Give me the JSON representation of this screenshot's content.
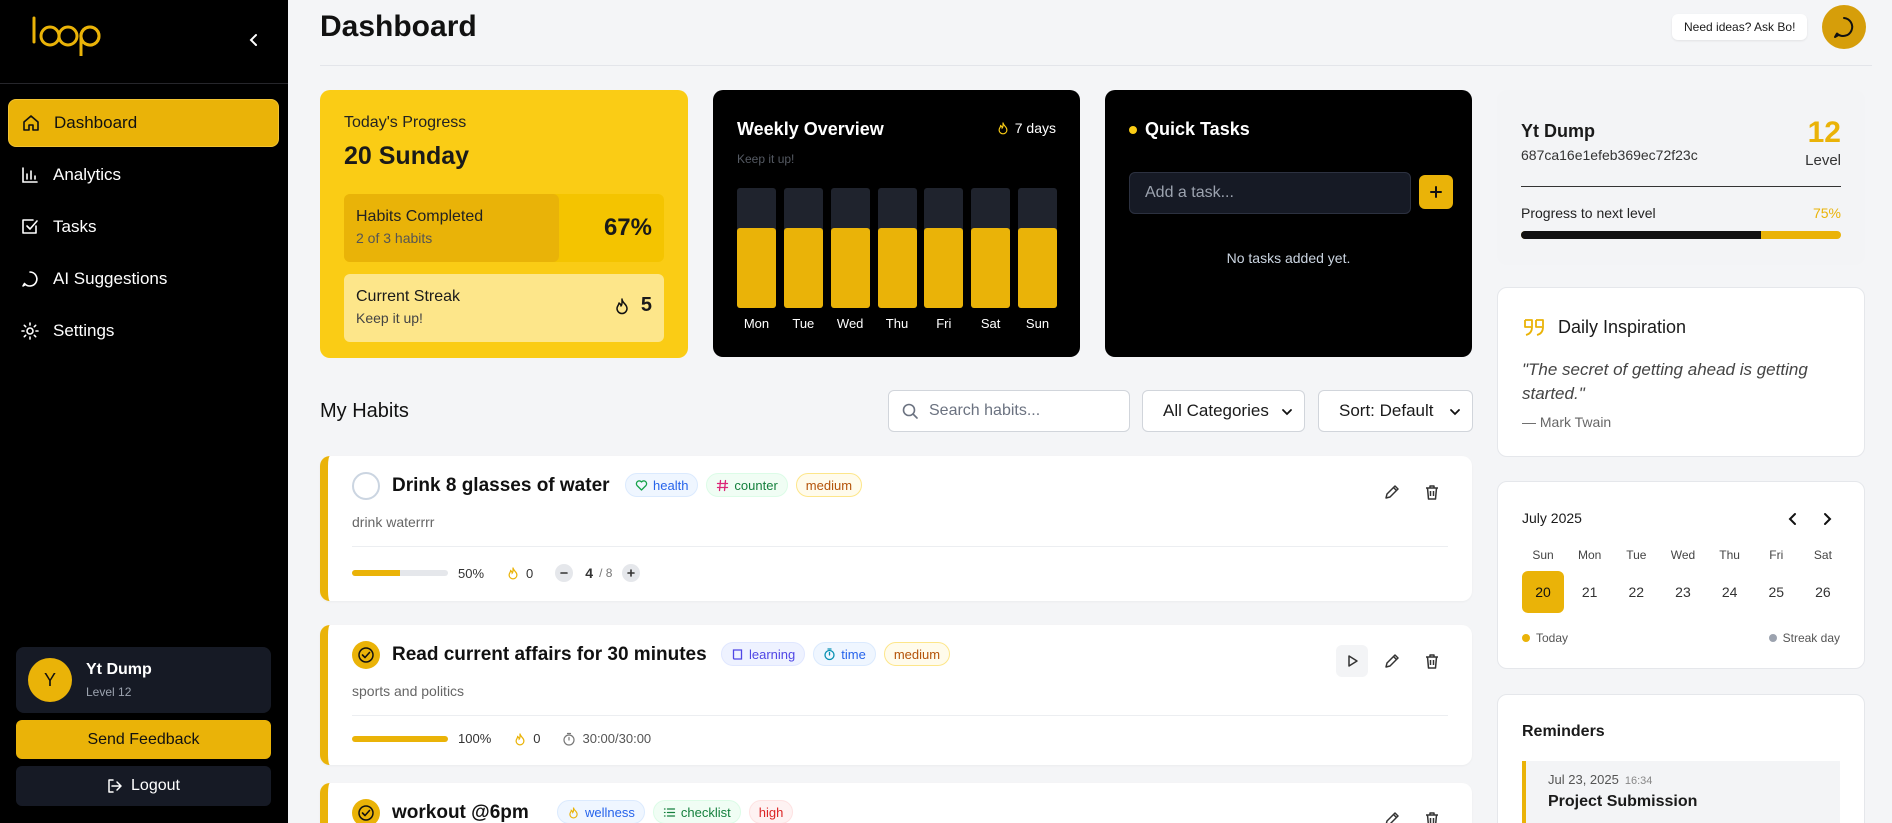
{
  "app": {
    "logo_text": "loop"
  },
  "sidebar": {
    "items": [
      {
        "label": "Dashboard",
        "icon": "home-icon",
        "active": true
      },
      {
        "label": "Analytics",
        "icon": "bar-chart-icon"
      },
      {
        "label": "Tasks",
        "icon": "checkbox-icon"
      },
      {
        "label": "AI Suggestions",
        "icon": "message-icon"
      },
      {
        "label": "Settings",
        "icon": "gear-icon"
      }
    ],
    "user": {
      "initial": "Y",
      "name": "Yt Dump",
      "level": "Level 12"
    },
    "feedback_label": "Send Feedback",
    "logout_label": "Logout"
  },
  "header": {
    "title": "Dashboard",
    "ask_label": "Need ideas? Ask Bo!"
  },
  "progress_card": {
    "label": "Today's Progress",
    "date": "20 Sunday",
    "habits_title": "Habits Completed",
    "habits_sub": "2 of 3 habits",
    "habits_pct": "67%",
    "streak_title": "Current Streak",
    "streak_sub": "Keep it up!",
    "streak_value": "5"
  },
  "weekly": {
    "title": "Weekly Overview",
    "subtitle": "Keep it up!",
    "streak_label": "7 days"
  },
  "chart_data": {
    "type": "bar",
    "categories": [
      "Mon",
      "Tue",
      "Wed",
      "Thu",
      "Fri",
      "Sat",
      "Sun"
    ],
    "values": [
      67,
      67,
      67,
      67,
      67,
      67,
      67
    ],
    "ylim": [
      0,
      100
    ]
  },
  "quick_tasks": {
    "title": "Quick Tasks",
    "placeholder": "Add a task...",
    "empty": "No tasks added yet."
  },
  "level_card": {
    "name": "Yt Dump",
    "user_id": "687ca16e1efeb369ec72f23c",
    "level": "12",
    "level_label": "Level",
    "progress_label": "Progress to next level",
    "progress_pct": "75%",
    "progress_fraction": 0.75
  },
  "inspiration": {
    "title": "Daily Inspiration",
    "quote": "\"The secret of getting ahead is getting started.\"",
    "author": "— Mark Twain"
  },
  "calendar": {
    "month": "July 2025",
    "dows": [
      "Sun",
      "Mon",
      "Tue",
      "Wed",
      "Thu",
      "Fri",
      "Sat"
    ],
    "days": [
      "20",
      "21",
      "22",
      "23",
      "24",
      "25",
      "26"
    ],
    "legend_today": "Today",
    "legend_streak": "Streak day"
  },
  "reminders": {
    "title": "Reminders",
    "items": [
      {
        "date": "Jul 23, 2025",
        "time": "16:34",
        "name": "Project Submission"
      }
    ]
  },
  "habits": {
    "title": "My Habits",
    "search_placeholder": "Search habits...",
    "category_value": "All Categories",
    "sort_value": "Sort: Default",
    "items": [
      {
        "name": "Drink 8 glasses of water",
        "tags": [
          "health",
          "counter",
          "medium"
        ],
        "desc": "drink waterrrr",
        "pct": "50%",
        "fraction": 0.5,
        "streak": "0",
        "count": "4",
        "max": "/ 8"
      },
      {
        "name": "Read current affairs for 30 minutes",
        "tags": [
          "learning",
          "time",
          "medium"
        ],
        "desc": "sports and politics",
        "pct": "100%",
        "fraction": 1.0,
        "streak": "0",
        "timer": "30:00/30:00"
      },
      {
        "name": "workout @6pm",
        "tags": [
          "wellness",
          "checklist",
          "high"
        ]
      }
    ]
  },
  "colors": {
    "accent": "#eab308",
    "sidebar_bg": "#000000",
    "card_yellow": "#facc15"
  }
}
